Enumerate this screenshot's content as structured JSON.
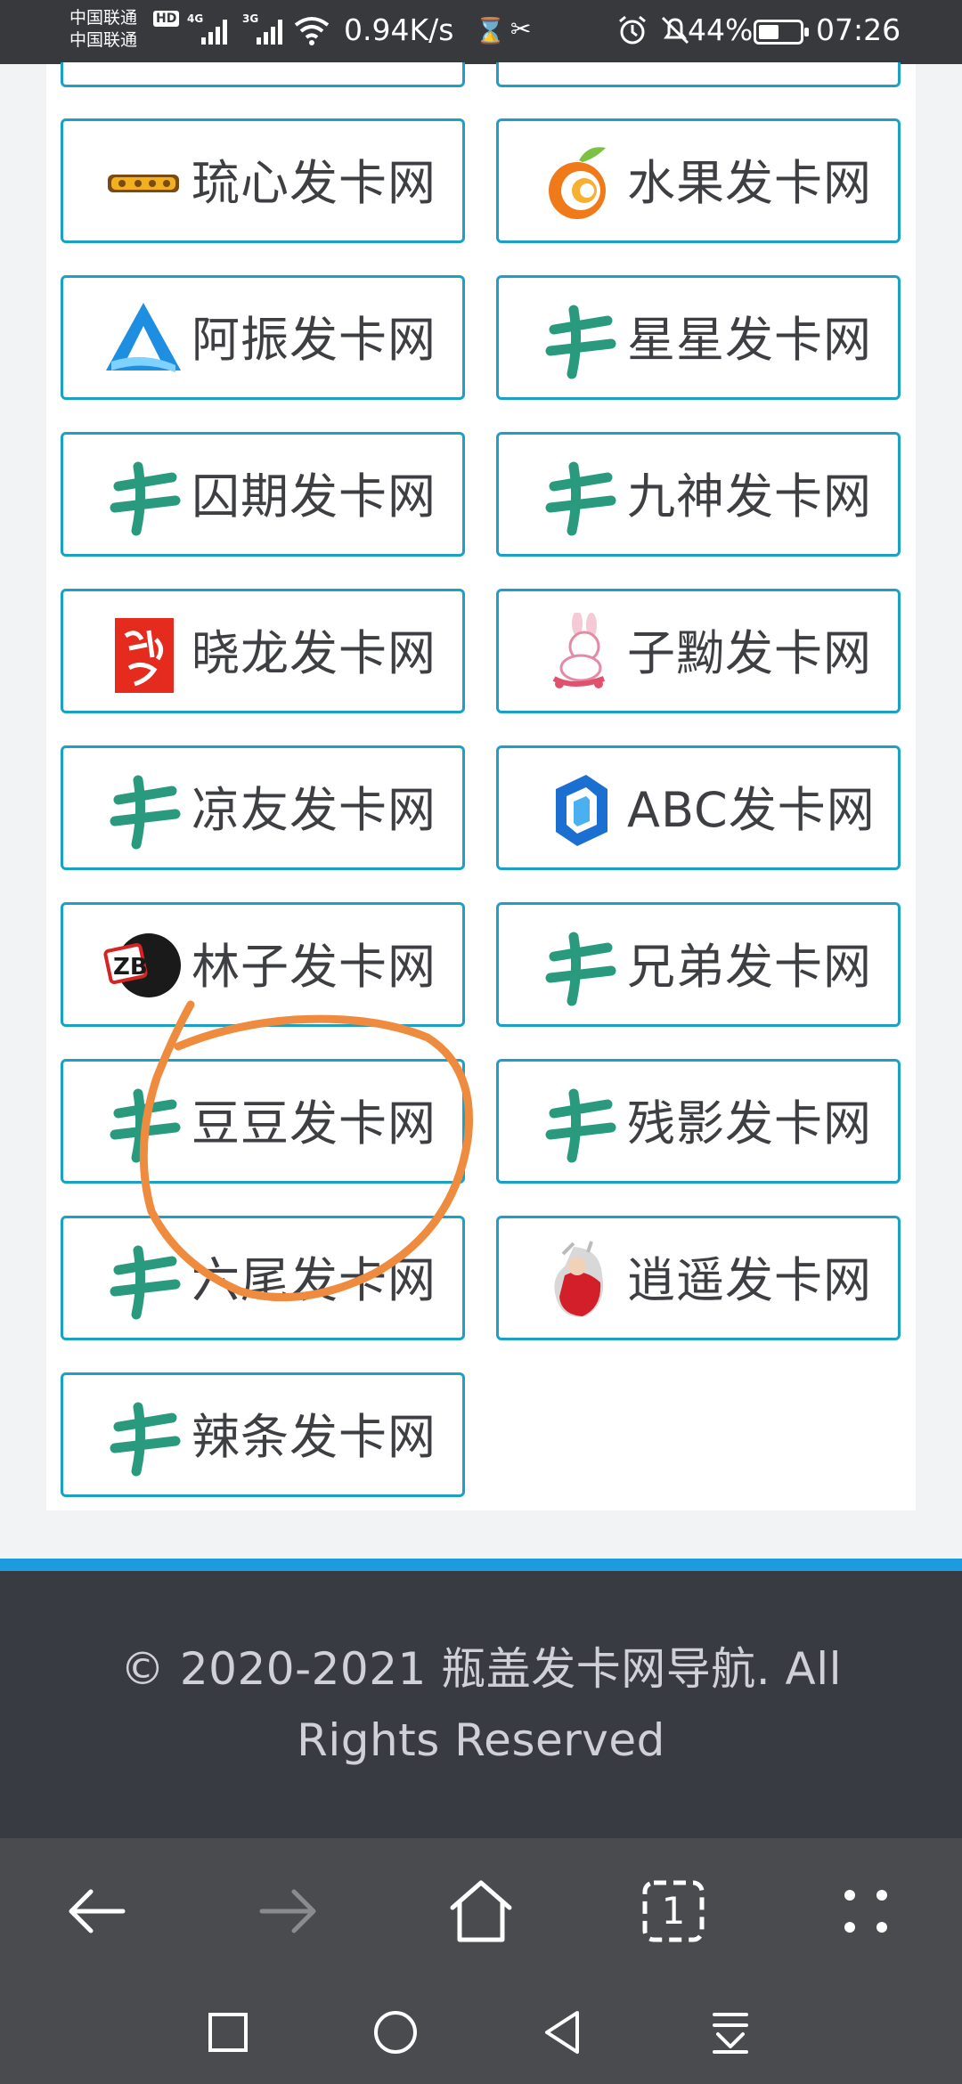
{
  "status_bar": {
    "carrier_1": "中国联通",
    "carrier_2": "中国联通",
    "hd": "HD",
    "net_1": "4G",
    "net_2": "3G",
    "net_speed": "0.94K/s",
    "battery": "44%",
    "battery_level": 0.44,
    "time": "07:26",
    "icons": [
      "hourglass-icon",
      "misc-app-icon",
      "alarm-icon",
      "mute-icon",
      "battery-icon",
      "wifi-icon",
      "signal-icon"
    ]
  },
  "sites": [
    {
      "name": "琉心发卡网",
      "logo": "liuxin-logo"
    },
    {
      "name": "水果发卡网",
      "logo": "fruit-logo"
    },
    {
      "name": "阿振发卡网",
      "logo": "azhen-logo"
    },
    {
      "name": "星星发卡网",
      "logo": "ka-logo"
    },
    {
      "name": "囚期发卡网",
      "logo": "ka-logo"
    },
    {
      "name": "九神发卡网",
      "logo": "ka-logo"
    },
    {
      "name": "晓龙发卡网",
      "logo": "xiaolong-logo"
    },
    {
      "name": "子黝发卡网",
      "logo": "rabbit-logo"
    },
    {
      "name": "凉友发卡网",
      "logo": "ka-logo"
    },
    {
      "name": "ABC发卡网",
      "logo": "abc-logo"
    },
    {
      "name": "林子发卡网",
      "logo": "linzi-logo"
    },
    {
      "name": "兄弟发卡网",
      "logo": "ka-logo"
    },
    {
      "name": "豆豆发卡网",
      "logo": "ka-logo"
    },
    {
      "name": "残影发卡网",
      "logo": "ka-logo"
    },
    {
      "name": "六尾发卡网",
      "logo": "ka-logo"
    },
    {
      "name": "逍遥发卡网",
      "logo": "xiaoyao-logo"
    },
    {
      "name": "辣条发卡网",
      "logo": "ka-logo"
    }
  ],
  "colors": {
    "card_border": "#1aa1c4",
    "ka_logo": "#2a9a7f",
    "annotation": "#ef8b3f",
    "footer_accent": "#1e9bde",
    "footer_bg": "#393b42"
  },
  "footer": {
    "copyright": "© 2020-2021 瓶盖发卡网导航. All Rights Reserved"
  },
  "browser_toolbar": {
    "tab_count": "1",
    "buttons": [
      "back-icon",
      "forward-icon",
      "home-icon",
      "tabs-icon",
      "more-icon"
    ]
  },
  "nav_bar": {
    "buttons": [
      "recents-icon",
      "home-circle-icon",
      "back-triangle-icon",
      "notification-pulldown-icon"
    ]
  }
}
